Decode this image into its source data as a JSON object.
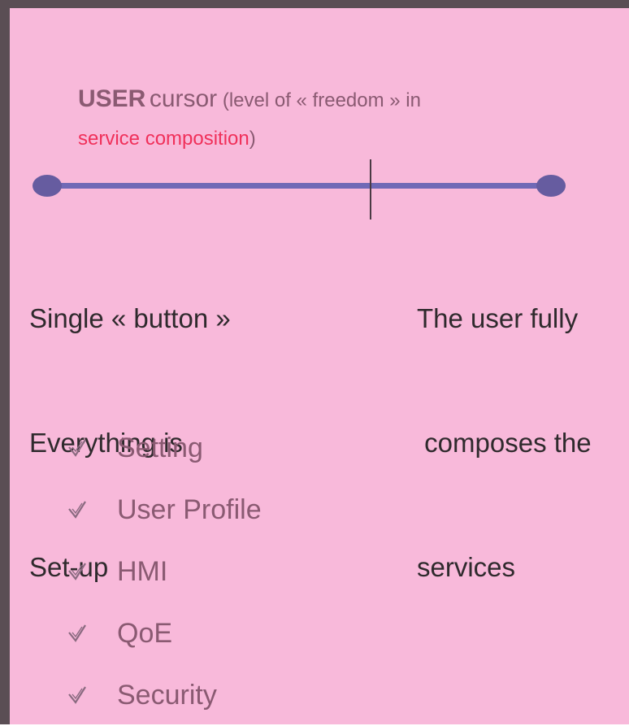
{
  "heading": {
    "bold": "USER",
    "cursor": "cursor",
    "paren_open": " (level of « freedom » in",
    "accent": "service composition",
    "paren_close": ")"
  },
  "slider": {
    "left_label_lines": [
      "Single « button »",
      "Everything is",
      "Set-up"
    ],
    "right_label_lines": [
      "The user fully",
      " composes the",
      "services"
    ],
    "marker_position_fraction": 0.63,
    "track_color": "#7069b6"
  },
  "checklist": {
    "items": [
      {
        "label": "Setting",
        "icon": "checkmark-icon"
      },
      {
        "label": "User Profile",
        "icon": "checkmark-icon"
      },
      {
        "label": "HMI",
        "icon": "checkmark-icon"
      },
      {
        "label": "QoE",
        "icon": "checkmark-icon"
      },
      {
        "label": "Security",
        "icon": "checkmark-icon"
      }
    ]
  },
  "colors": {
    "background": "#f8b9da",
    "frame": "#5a4e54",
    "title": "#8a5a72",
    "accent": "#f0305a"
  }
}
